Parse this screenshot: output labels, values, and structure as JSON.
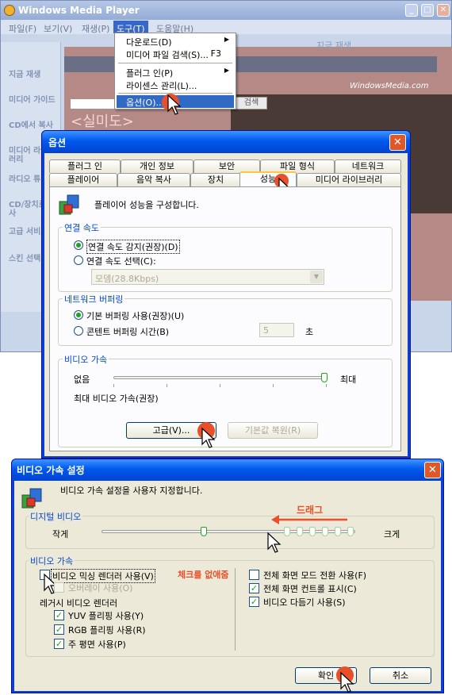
{
  "wmp": {
    "title": "Windows Media Player",
    "menu": [
      "파일(F)",
      "보기(V)",
      "재생(P)",
      "도구(T)",
      "도움말(H)"
    ],
    "active_menu_index": 3,
    "now_playing": "지금 재생",
    "sidebar": [
      "지금 재생",
      "미디어 가이드",
      "CD에서 복사",
      "미디어 라이브러리",
      "라디오 튜너",
      "CD/장치로 복사",
      "고급 서비스",
      "스킨 선택"
    ],
    "watermark": "WindowsMedia.com",
    "banner_text": "<실미도>",
    "search_button": "검색"
  },
  "tools_menu": {
    "items": [
      {
        "label": "다운로드(D)",
        "submenu": true
      },
      {
        "label": "미디어 파일 검색(S)...",
        "shortcut": "F3"
      },
      {
        "label": "플러그 인(P)",
        "submenu": true
      },
      {
        "label": "라이센스 관리(L)..."
      },
      {
        "label": "옵션(O)...",
        "selected": true
      }
    ]
  },
  "options_dialog": {
    "title": "옵션",
    "close": "✕",
    "tabs_row1": [
      "플러그 인",
      "개인 정보",
      "보안",
      "파일 형식",
      "네트워크"
    ],
    "tabs_row2": [
      "플레이어",
      "음악 복사",
      "장치",
      "성능",
      "미디어 라이브러리"
    ],
    "selected_tab": "성능",
    "description": "플레이어 성능을 구성합니다.",
    "connection": {
      "title": "연결 속도",
      "detect": "연결 속도 감지(권장)(D)",
      "choose": "연결 속도 선택(C):",
      "selected": "detect",
      "dropdown": "모뎀(28.8Kbps)"
    },
    "buffering": {
      "title": "네트워크 버퍼링",
      "default": "기본 버퍼링 사용(권장)(U)",
      "custom": "콘텐트 버퍼링 시간(B)",
      "selected": "default",
      "seconds": "5",
      "unit": "초"
    },
    "video": {
      "title": "비디오 가속",
      "min": "없음",
      "max": "최대",
      "level": 1.0,
      "status": "최대 비디오 가속(권장)"
    },
    "advanced_button": "고급(V)...",
    "restore_button": "기본값 복원(R)"
  },
  "va_dialog": {
    "title": "비디오 가속 설정",
    "close": "✕",
    "description": "비디오 가속 설정을 사용자 지정합니다.",
    "digital": {
      "title": "디지털 비디오",
      "min": "작게",
      "max": "크게",
      "level": 0.4,
      "drag_annotation": "드래그"
    },
    "accel": {
      "title": "비디오 가속",
      "mixing": {
        "label": "비디오 믹싱 렌더러 사용(V)",
        "checked": false
      },
      "overlay": {
        "label": "오버레이 사용(O)",
        "checked": false,
        "disabled": true
      },
      "uncheck_annotation": "체크를 없애줌",
      "legacy_title": "레거시 비디오 렌더러",
      "yuv": {
        "label": "YUV 플리핑 사용(Y)",
        "checked": true
      },
      "rgb": {
        "label": "RGB 플리핑 사용(R)",
        "checked": true
      },
      "primary": {
        "label": "주 평면 사용(P)",
        "checked": true
      },
      "fullscreen_switch": {
        "label": "전체 화면 모드 전환 사용(F)",
        "checked": false
      },
      "fullscreen_controls": {
        "label": "전체 화면 컨트롤 표시(C)",
        "checked": true
      },
      "tweening": {
        "label": "비디오 다듬기 사용(S)",
        "checked": true
      }
    },
    "ok": "확인",
    "cancel": "취소"
  },
  "colors": {
    "xp_blue": "#0058ee",
    "dialog_bg": "#ece9d8",
    "group_title": "#0046d5",
    "annotation_red": "#e8502a",
    "radio_green": "#21a121"
  }
}
